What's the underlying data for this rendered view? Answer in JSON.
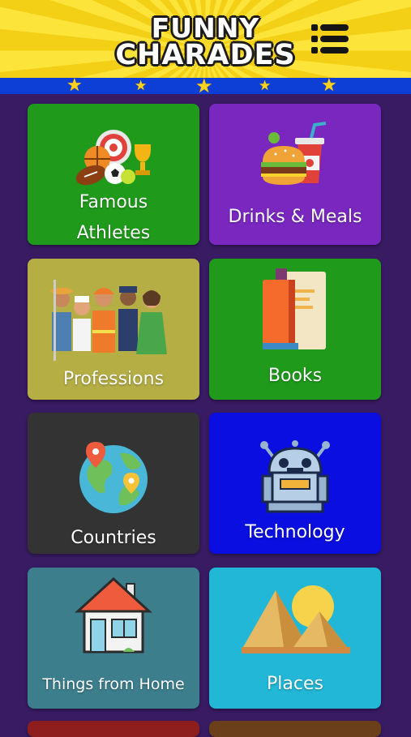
{
  "header": {
    "title_line1": "FUNNY",
    "title_line2": "CHARADES",
    "colors": {
      "yellow": "#fde43a",
      "band": "#0d3fd6",
      "star": "#ffd21e"
    }
  },
  "menu": {
    "icon": "menu-list-icon"
  },
  "background_color": "#381b63",
  "categories": [
    {
      "label_line1": "Famous",
      "label_line2": "Athletes",
      "color": "#1f9a1b",
      "icon": "sports-equipment-icon"
    },
    {
      "label": "Drinks & Meals",
      "color": "#7a27c0",
      "icon": "burger-drink-icon"
    },
    {
      "label": "Professions",
      "color": "#b5ae45",
      "icon": "workers-group-icon"
    },
    {
      "label": "Books",
      "color": "#1f9a1b",
      "icon": "books-icon"
    },
    {
      "label": "Countries",
      "color": "#333333",
      "icon": "globe-pins-icon"
    },
    {
      "label": "Technology",
      "color": "#0a0ee0",
      "icon": "robot-icon"
    },
    {
      "label": "Things from Home",
      "color": "#3c7e8c",
      "icon": "house-icon"
    },
    {
      "label": "Places",
      "color": "#22b7d6",
      "icon": "pyramids-icon"
    }
  ]
}
